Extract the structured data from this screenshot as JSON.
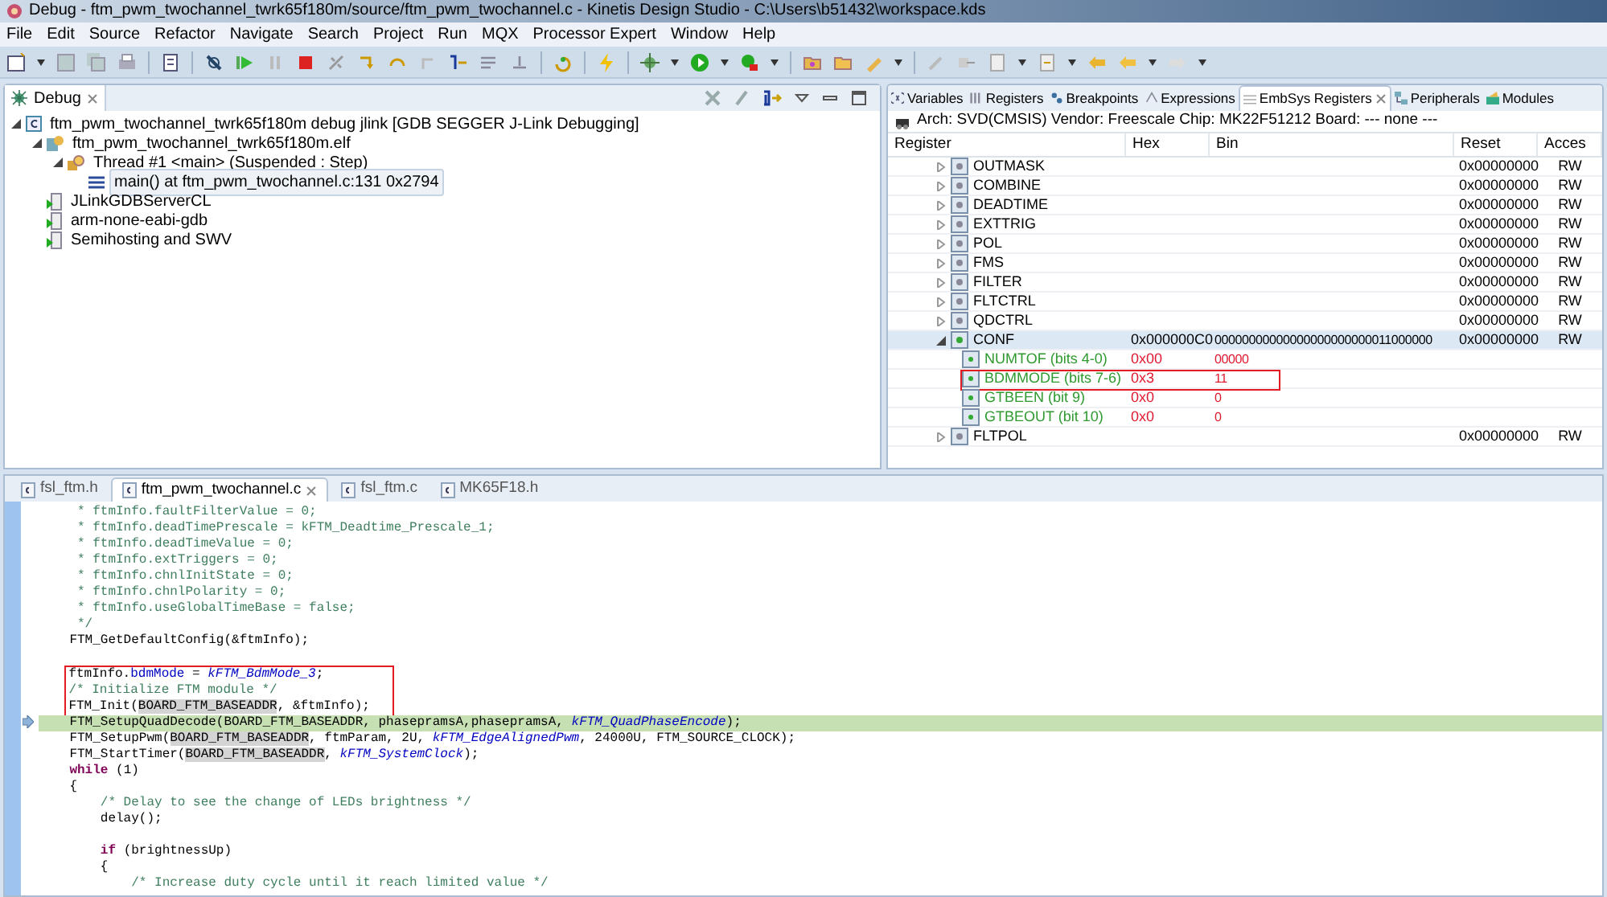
{
  "window": {
    "title": "Debug - ftm_pwm_twochannel_twrk65f180m/source/ftm_pwm_twochannel.c - Kinetis Design Studio - C:\\Users\\b51432\\workspace.kds"
  },
  "menu": [
    "File",
    "Edit",
    "Source",
    "Refactor",
    "Navigate",
    "Search",
    "Project",
    "Run",
    "MQX",
    "Processor Expert",
    "Window",
    "Help"
  ],
  "debug_view": {
    "tab": "Debug",
    "tree": [
      {
        "label": "ftm_pwm_twochannel_twrk65f180m debug jlink [GDB SEGGER J-Link Debugging]",
        "kind": "launch",
        "expanded": true,
        "selected": false,
        "children": [
          {
            "label": "ftm_pwm_twochannel_twrk65f180m.elf",
            "kind": "process",
            "expanded": true,
            "selected": false,
            "children": [
              {
                "label": "Thread #1 <main> (Suspended : Step)",
                "kind": "thread",
                "expanded": true,
                "selected": false,
                "children": [
                  {
                    "label": "main() at ftm_pwm_twochannel.c:131 0x2794",
                    "kind": "frame",
                    "selected": true
                  }
                ]
              }
            ]
          },
          {
            "label": "JLinkGDBServerCL",
            "kind": "server",
            "selected": false
          },
          {
            "label": "arm-none-eabi-gdb",
            "kind": "server",
            "selected": false
          },
          {
            "label": "Semihosting and SWV",
            "kind": "server",
            "selected": false
          }
        ]
      }
    ]
  },
  "register_view": {
    "tabs": [
      {
        "label": "Variables",
        "selected": false
      },
      {
        "label": "Registers",
        "selected": false
      },
      {
        "label": "Breakpoints",
        "selected": false
      },
      {
        "label": "Expressions",
        "selected": false
      },
      {
        "label": "EmbSys Registers",
        "selected": true
      },
      {
        "label": "Peripherals",
        "selected": false
      },
      {
        "label": "Modules",
        "selected": false
      }
    ],
    "info": "Arch: SVD(CMSIS)  Vendor: Freescale  Chip: MK22F51212  Board: ---  none ---",
    "columns": [
      "Register",
      "Hex",
      "Bin",
      "Reset",
      "Acces"
    ],
    "rows": [
      {
        "kind": "register",
        "name": "OUTMASK",
        "reset": "0x00000000",
        "access": "RW",
        "expanded": false,
        "selected": false
      },
      {
        "kind": "register",
        "name": "COMBINE",
        "reset": "0x00000000",
        "access": "RW",
        "expanded": false,
        "selected": false
      },
      {
        "kind": "register",
        "name": "DEADTIME",
        "reset": "0x00000000",
        "access": "RW",
        "expanded": false,
        "selected": false
      },
      {
        "kind": "register",
        "name": "EXTTRIG",
        "reset": "0x00000000",
        "access": "RW",
        "expanded": false,
        "selected": false
      },
      {
        "kind": "register",
        "name": "POL",
        "reset": "0x00000000",
        "access": "RW",
        "expanded": false,
        "selected": false
      },
      {
        "kind": "register",
        "name": "FMS",
        "reset": "0x00000000",
        "access": "RW",
        "expanded": false,
        "selected": false
      },
      {
        "kind": "register",
        "name": "FILTER",
        "reset": "0x00000000",
        "access": "RW",
        "expanded": false,
        "selected": false
      },
      {
        "kind": "register",
        "name": "FLTCTRL",
        "reset": "0x00000000",
        "access": "RW",
        "expanded": false,
        "selected": false
      },
      {
        "kind": "register",
        "name": "QDCTRL",
        "reset": "0x00000000",
        "access": "RW",
        "expanded": false,
        "selected": false
      },
      {
        "kind": "register",
        "name": "CONF",
        "hex": "0x000000C0",
        "bin": "00000000000000000000000011000000",
        "reset": "0x00000000",
        "access": "RW",
        "expanded": true,
        "selected": true
      },
      {
        "kind": "field",
        "name": "NUMTOF (bits 4-0)",
        "hex": "0x00",
        "bin": "00000",
        "annotated": false
      },
      {
        "kind": "field",
        "name": "BDMMODE (bits 7-6)",
        "hex": "0x3",
        "bin": "11",
        "annotated": true
      },
      {
        "kind": "field",
        "name": "GTBEEN (bit 9)",
        "hex": "0x0",
        "bin": "0",
        "annotated": false
      },
      {
        "kind": "field",
        "name": "GTBEOUT (bit 10)",
        "hex": "0x0",
        "bin": "0",
        "annotated": false
      },
      {
        "kind": "register",
        "name": "FLTPOL",
        "reset": "0x00000000",
        "access": "RW",
        "expanded": false,
        "selected": false
      }
    ]
  },
  "editor": {
    "tabs": [
      {
        "label": "fsl_ftm.h",
        "selected": false
      },
      {
        "label": "ftm_pwm_twochannel.c",
        "selected": true
      },
      {
        "label": "fsl_ftm.c",
        "selected": false
      },
      {
        "label": "MK65F18.h",
        "selected": false
      }
    ],
    "lines": [
      {
        "current": false,
        "annotated": false,
        "parts": [
          {
            "kind": "comment",
            "text": "     * ftmInfo.faultFilterValue = 0;"
          }
        ]
      },
      {
        "current": false,
        "annotated": false,
        "parts": [
          {
            "kind": "comment",
            "text": "     * ftmInfo.deadTimePrescale = kFTM_Deadtime_Prescale_1;"
          }
        ]
      },
      {
        "current": false,
        "annotated": false,
        "parts": [
          {
            "kind": "comment",
            "text": "     * ftmInfo.deadTimeValue = 0;"
          }
        ]
      },
      {
        "current": false,
        "annotated": false,
        "parts": [
          {
            "kind": "comment",
            "text": "     * ftmInfo.extTriggers = 0;"
          }
        ]
      },
      {
        "current": false,
        "annotated": false,
        "parts": [
          {
            "kind": "comment",
            "text": "     * ftmInfo.chnlInitState = 0;"
          }
        ]
      },
      {
        "current": false,
        "annotated": false,
        "parts": [
          {
            "kind": "comment",
            "text": "     * ftmInfo.chnlPolarity = 0;"
          }
        ]
      },
      {
        "current": false,
        "annotated": false,
        "parts": [
          {
            "kind": "comment",
            "text": "     * ftmInfo.useGlobalTimeBase = false;"
          }
        ]
      },
      {
        "current": false,
        "annotated": false,
        "parts": [
          {
            "kind": "comment",
            "text": "     */"
          }
        ]
      },
      {
        "current": false,
        "annotated": false,
        "parts": [
          {
            "kind": "plain",
            "text": "    FTM_GetDefaultConfig(&ftmInfo);"
          }
        ]
      },
      {
        "current": false,
        "annotated": false
      },
      {
        "current": false,
        "annotated": true,
        "parts": [
          {
            "kind": "plain",
            "text": "    ftmInfo."
          },
          {
            "kind": "field",
            "text": "bdmMode"
          },
          {
            "kind": "plain",
            "text": " = "
          },
          {
            "kind": "enum",
            "text": "kFTM_BdmMode_3"
          },
          {
            "kind": "plain",
            "text": ";"
          }
        ]
      },
      {
        "current": false,
        "annotated": true,
        "parts": [
          {
            "kind": "comment",
            "text": "    /* Initialize FTM module */"
          }
        ]
      },
      {
        "current": false,
        "annotated": true,
        "parts": [
          {
            "kind": "plain",
            "text": "    FTM_Init("
          },
          {
            "kind": "occurrence",
            "text": "BOARD_FTM_BASEADDR"
          },
          {
            "kind": "plain",
            "text": ", &ftmInfo);"
          }
        ]
      },
      {
        "current": true,
        "annotated": false,
        "parts": [
          {
            "kind": "plain",
            "text": "    FTM_SetupQuadDecode(BOARD_FTM_BASEADDR, phasepramsA,phasepramsA, "
          },
          {
            "kind": "enum",
            "text": "kFTM_QuadPhaseEncode"
          },
          {
            "kind": "plain",
            "text": ");"
          }
        ]
      },
      {
        "current": false,
        "annotated": false,
        "parts": [
          {
            "kind": "plain",
            "text": "    FTM_SetupPwm("
          },
          {
            "kind": "occurrence",
            "text": "BOARD_FTM_BASEADDR"
          },
          {
            "kind": "plain",
            "text": ", ftmParam, 2U, "
          },
          {
            "kind": "enum",
            "text": "kFTM_EdgeAlignedPwm"
          },
          {
            "kind": "plain",
            "text": ", 24000U, FTM_SOURCE_CLOCK);"
          }
        ]
      },
      {
        "current": false,
        "annotated": false,
        "parts": [
          {
            "kind": "plain",
            "text": "    FTM_StartTimer("
          },
          {
            "kind": "occurrence",
            "text": "BOARD_FTM_BASEADDR"
          },
          {
            "kind": "plain",
            "text": ", "
          },
          {
            "kind": "enum",
            "text": "kFTM_SystemClock"
          },
          {
            "kind": "plain",
            "text": ");"
          }
        ]
      },
      {
        "current": false,
        "annotated": false,
        "parts": [
          {
            "kind": "keyword",
            "text": "    while"
          },
          {
            "kind": "plain",
            "text": " (1)"
          }
        ]
      },
      {
        "current": false,
        "annotated": false,
        "parts": [
          {
            "kind": "plain",
            "text": "    {"
          }
        ]
      },
      {
        "current": false,
        "annotated": false,
        "parts": [
          {
            "kind": "comment",
            "text": "        /* Delay to see the change of LEDs brightness */"
          }
        ]
      },
      {
        "current": false,
        "annotated": false,
        "parts": [
          {
            "kind": "plain",
            "text": "        delay();"
          }
        ]
      },
      {
        "current": false,
        "annotated": false
      },
      {
        "current": false,
        "annotated": false,
        "parts": [
          {
            "kind": "keyword",
            "text": "        if"
          },
          {
            "kind": "plain",
            "text": " (brightnessUp)"
          }
        ]
      },
      {
        "current": false,
        "annotated": false,
        "parts": [
          {
            "kind": "plain",
            "text": "        {"
          }
        ]
      },
      {
        "current": false,
        "annotated": false,
        "parts": [
          {
            "kind": "comment",
            "text": "            /* Increase duty cycle until it reach limited value */"
          }
        ]
      }
    ]
  }
}
